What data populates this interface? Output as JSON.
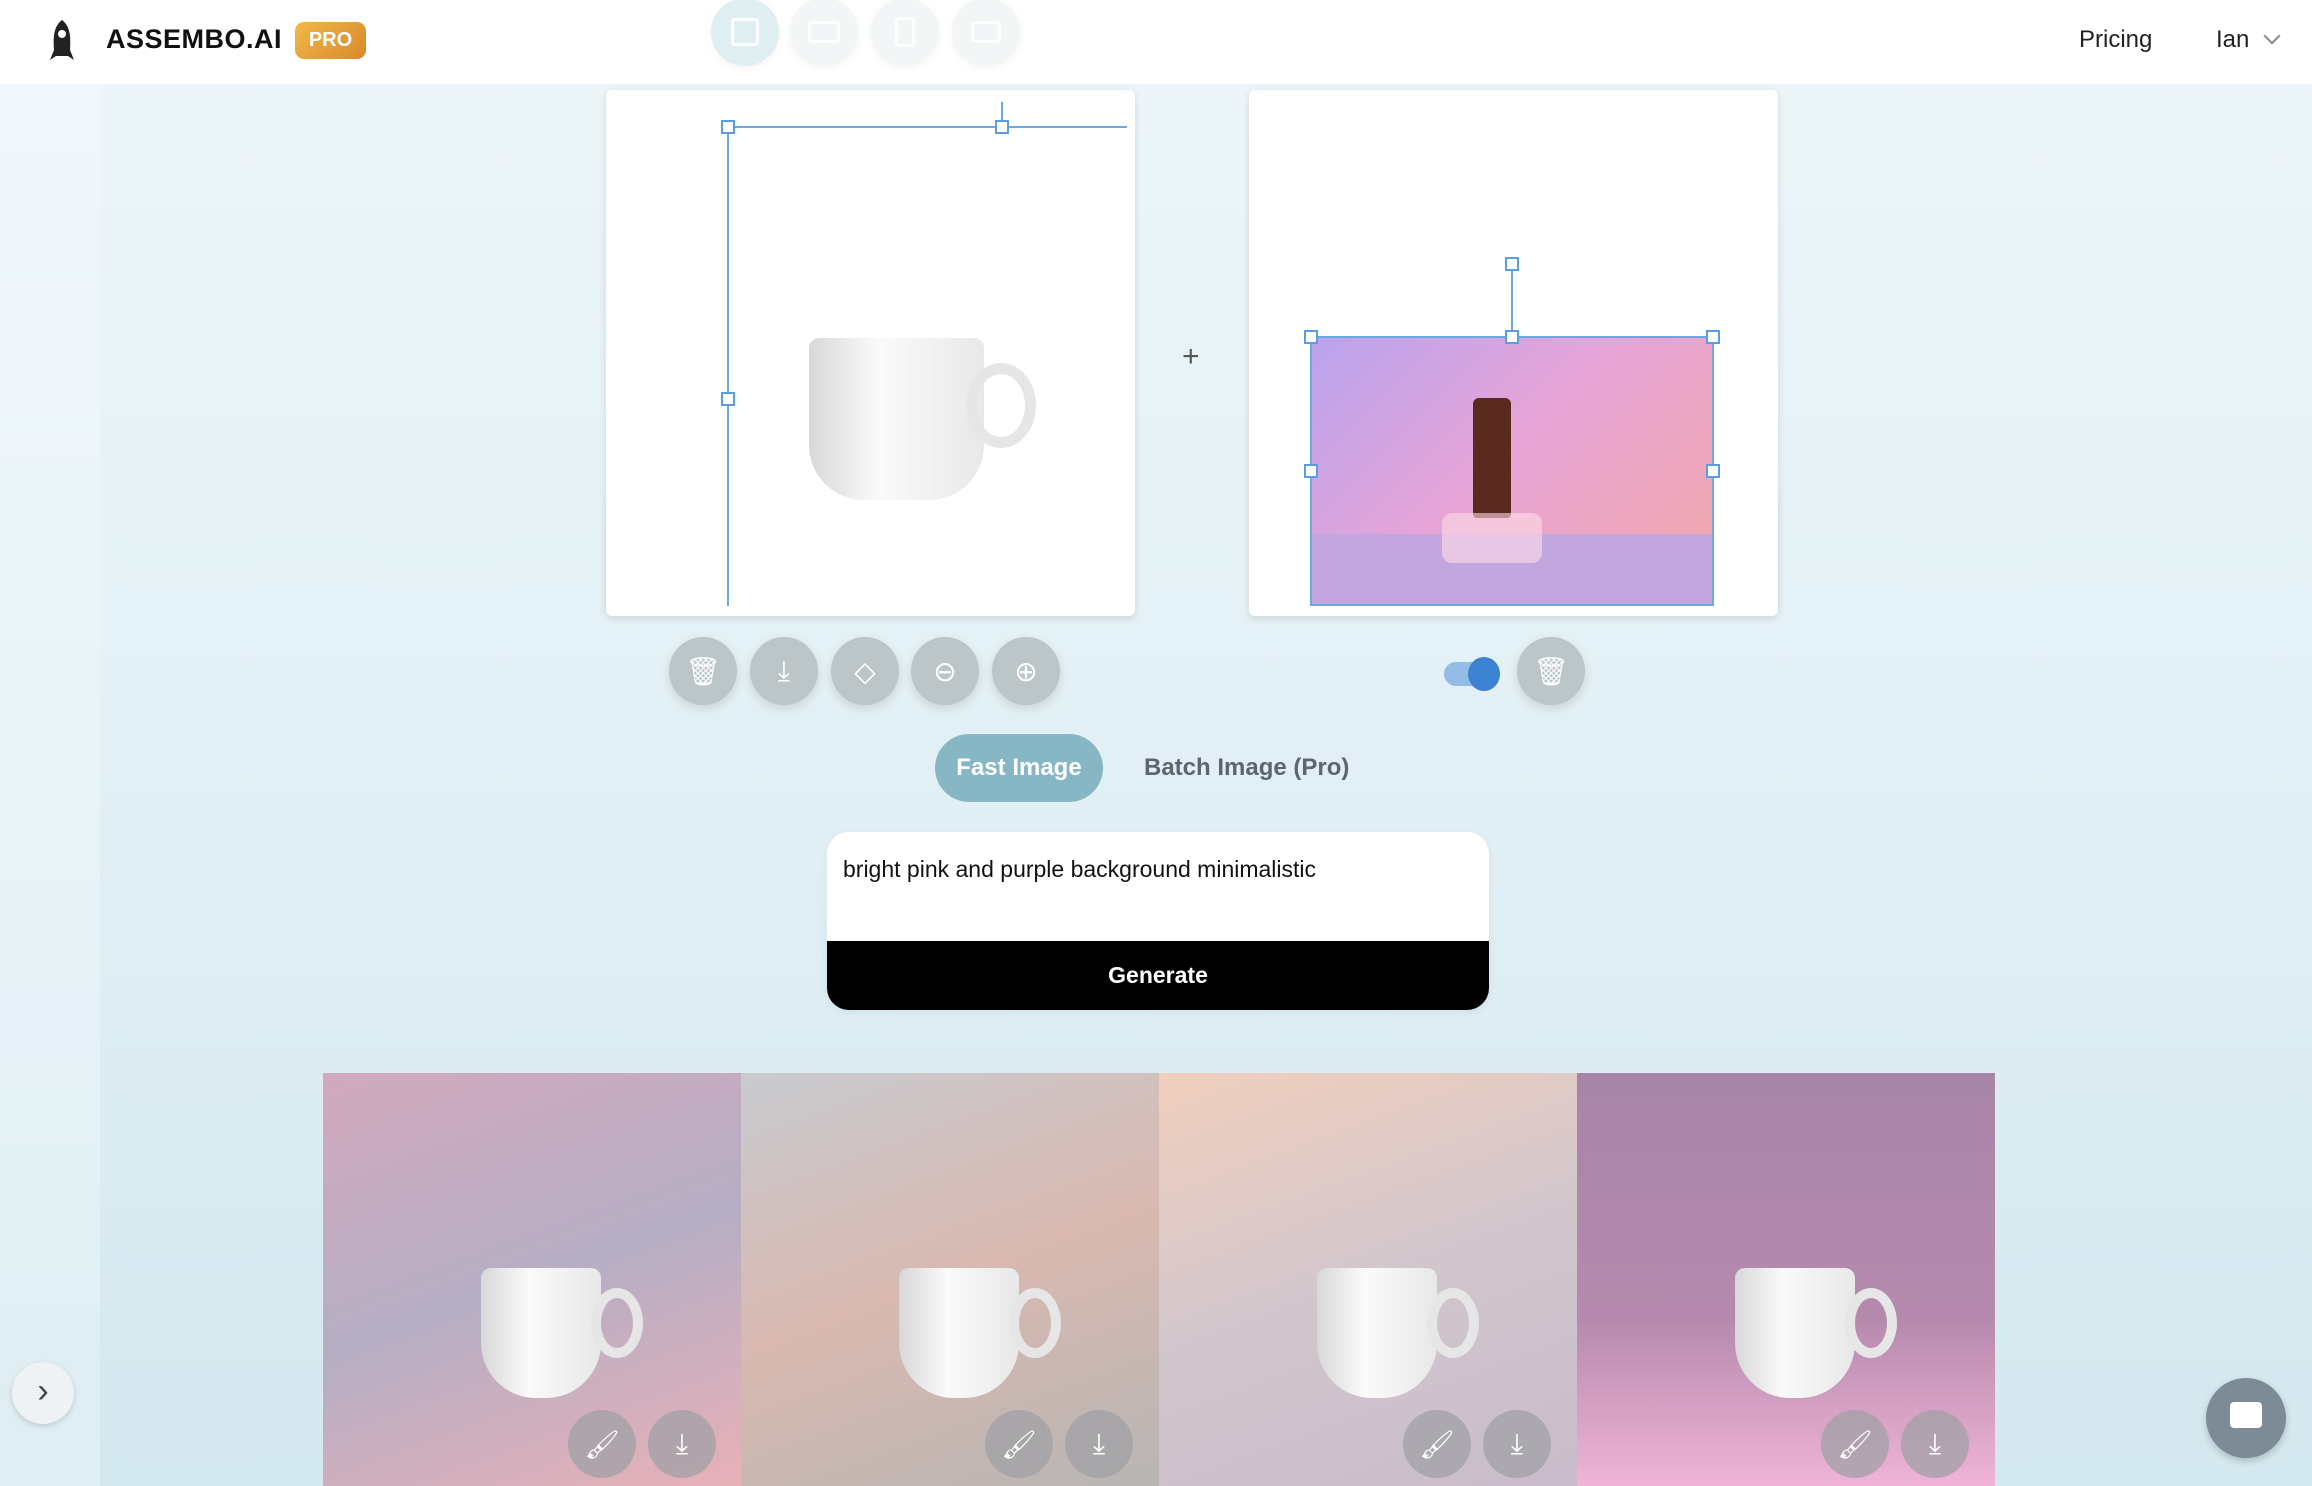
{
  "header": {
    "brand": "ASSEMBO.AI",
    "badge": "PRO",
    "nav": {
      "pricing": "Pricing",
      "user": "Ian"
    },
    "aspect_ratios": [
      "square",
      "landscape",
      "portrait",
      "wide"
    ],
    "active_aspect": "square"
  },
  "canvas": {
    "plus": "+",
    "toggle_on": true
  },
  "tabs": {
    "fast": "Fast Image",
    "batch": "Batch Image (Pro)",
    "active": "fast"
  },
  "prompt": {
    "value": "bright pink and purple background minimalistic",
    "generate": "Generate"
  },
  "results": [
    {
      "bg": "#c8a8b8"
    },
    {
      "bg": "#c9c4c2"
    },
    {
      "bg": "#e8cfc0"
    },
    {
      "bg": "#b88aaa"
    }
  ],
  "colors": {
    "accent": "#87b7c4",
    "selection": "#6aa9e0",
    "toggle": "#3b82d0"
  }
}
